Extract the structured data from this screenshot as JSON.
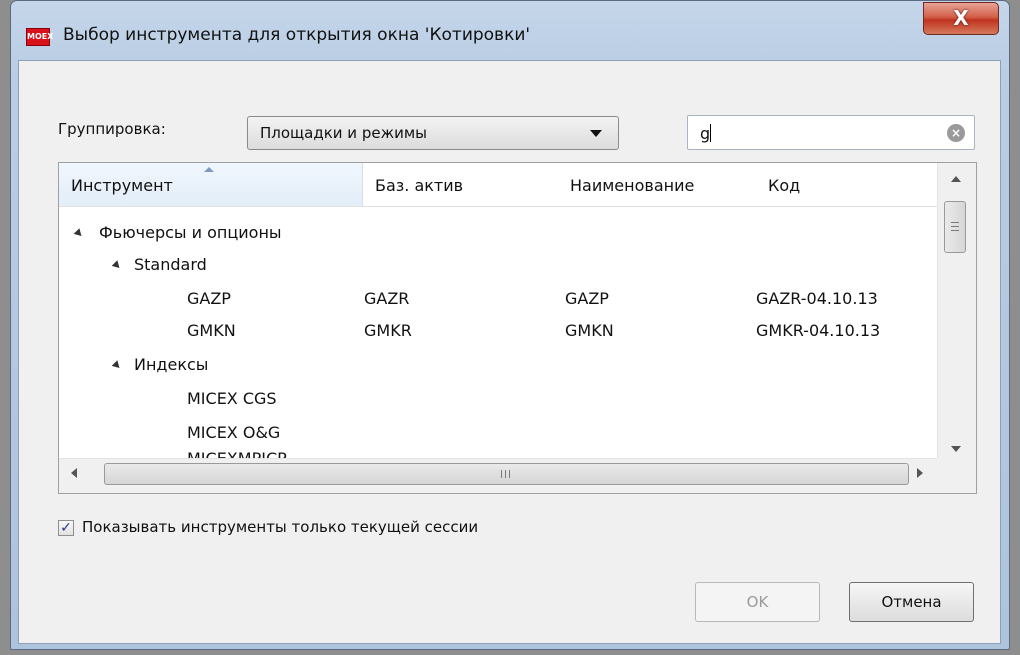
{
  "window": {
    "title": "Выбор инструмента для открытия окна 'Котировки'",
    "app_icon": "moex-icon",
    "close_label": "X"
  },
  "filters": {
    "group_label": "Группировка:",
    "group_value": "Площадки и режимы",
    "search_value": "g"
  },
  "grid": {
    "columns": [
      "Инструмент",
      "Баз. актив",
      "Наименование",
      "Код"
    ],
    "groups": [
      {
        "label": "Фьючерсы и опционы"
      },
      {
        "label": "Standard"
      },
      {
        "label": "Индексы"
      }
    ],
    "rows": [
      {
        "instrument": "GAZP",
        "base": "GAZR",
        "name": "GAZP",
        "code": "GAZR-04.10.13"
      },
      {
        "instrument": "GMKN",
        "base": "GMKR",
        "name": "GMKN",
        "code": "GMKR-04.10.13"
      },
      {
        "instrument": "MICEX CGS",
        "base": "",
        "name": "",
        "code": ""
      },
      {
        "instrument": "MICEX O&G",
        "base": "",
        "name": "",
        "code": ""
      },
      {
        "instrument": "MICEXMPICP",
        "base": "",
        "name": "",
        "code": ""
      }
    ],
    "hscroll_grip": "III"
  },
  "options": {
    "current_session_label": "Показывать инструменты только текущей сессии",
    "current_session_checked": true
  },
  "buttons": {
    "ok_label": "OK",
    "cancel_label": "Отмена"
  }
}
